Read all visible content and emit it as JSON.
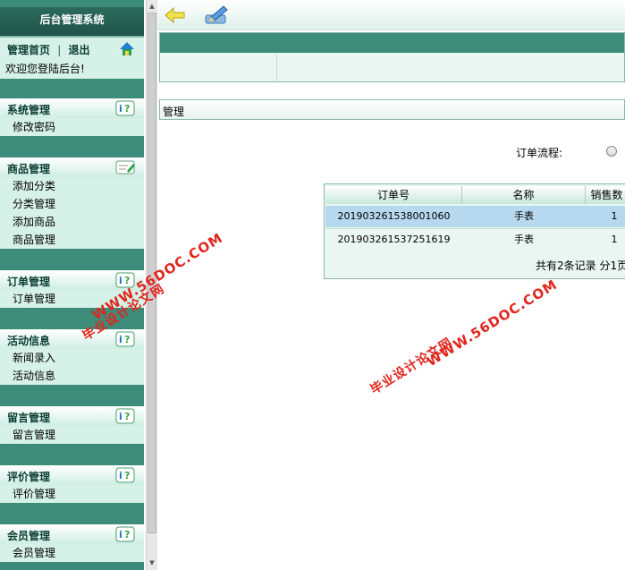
{
  "sidebar": {
    "title": "后台管理系统",
    "home_link": "管理首页",
    "separator": "|",
    "logout_link": "退出",
    "welcome": "欢迎您登陆后台!",
    "groups": [
      {
        "title": "系统管理",
        "items": [
          "修改密码"
        ]
      },
      {
        "title": "商品管理",
        "items": [
          "添加分类",
          "分类管理",
          "添加商品",
          "商品管理"
        ]
      },
      {
        "title": "订单管理",
        "items": [
          "订单管理"
        ]
      },
      {
        "title": "活动信息",
        "items": [
          "新闻录入",
          "活动信息"
        ]
      },
      {
        "title": "留言管理",
        "items": [
          "留言管理"
        ]
      },
      {
        "title": "评价管理",
        "items": [
          "评价管理"
        ]
      },
      {
        "title": "会员管理",
        "items": [
          "会员管理"
        ]
      }
    ]
  },
  "main": {
    "section_label": "管理",
    "flow_label": "订单流程:",
    "table": {
      "columns": [
        "订单号",
        "名称",
        "销售数"
      ],
      "rows": [
        {
          "order_no": "201903261538001060",
          "name": "手表",
          "qty": "1"
        },
        {
          "order_no": "201903261537251619",
          "name": "手表",
          "qty": "1"
        }
      ],
      "total_text": "共有2条记录  分1页"
    }
  },
  "watermarks": {
    "site": "WWW.56DOC.COM",
    "caption": "毕业设计论文网"
  },
  "colors": {
    "sidebar_bg": "#3d8c7a",
    "menu_bg": "#d6f1e7",
    "selected_row": "#b7d9f0",
    "watermark": "#e0261e"
  }
}
